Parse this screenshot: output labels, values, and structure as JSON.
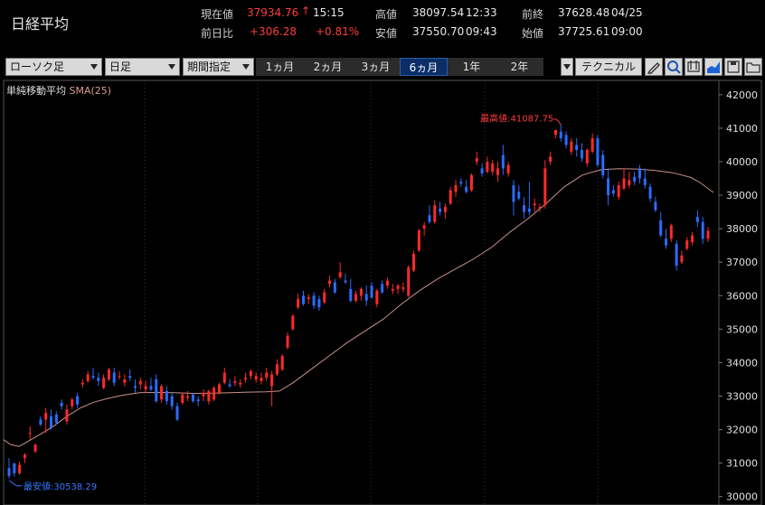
{
  "header": {
    "title": "日経平均",
    "current_label": "現在値",
    "current_value": "37934.76",
    "current_arrow": "↑",
    "current_time": "15:15",
    "change_label": "前日比",
    "change_value": "+306.28",
    "change_pct": "+0.81%",
    "high_label": "高値",
    "high_value": "38097.54",
    "high_time": "12:33",
    "low_label": "安値",
    "low_value": "37550.70",
    "low_time": "09:43",
    "prev_close_label": "前終",
    "prev_close_value": "37628.48",
    "prev_close_date": "04/25",
    "open_label": "始値",
    "open_value": "37725.61",
    "open_time": "09:00"
  },
  "toolbar": {
    "chart_type": "ローソク足",
    "interval": "日足",
    "range_mode": "期間指定",
    "periods": [
      "1ヵ月",
      "2ヵ月",
      "3ヵ月",
      "6ヵ月",
      "1年",
      "2年"
    ],
    "active_period": "6ヵ月",
    "technical_label": "テクニカル",
    "tool_icons": [
      "pencil-icon",
      "zoom-icon",
      "export-icon",
      "area-chart-icon",
      "save-icon",
      "folder-icon"
    ]
  },
  "indicator": {
    "name": "単純移動平均",
    "sma": "SMA(25)"
  },
  "colors": {
    "up": "#ff2a2a",
    "down": "#2b6cff",
    "sma": "#c8908a",
    "grid": "#3a3a3a",
    "bg": "#000000",
    "accent": "#0a2e66"
  },
  "chart_data": {
    "type": "candlestick",
    "yticks": [
      42000,
      41000,
      40000,
      39000,
      38000,
      37000,
      36000,
      35000,
      34000,
      33000,
      32000,
      31000,
      30000
    ],
    "ylim": [
      29750,
      42400
    ],
    "annotations": {
      "max_label": "最高値:41087.75",
      "max_value": 41087.75,
      "min_label": "最安値:30538.29",
      "min_value": 30538.29
    },
    "grid": "vertical month separators, dotted",
    "candles": [
      [
        30850,
        31150,
        30538,
        30620
      ],
      [
        30990,
        31020,
        30600,
        30700
      ],
      [
        30700,
        31050,
        30650,
        30950
      ],
      [
        31150,
        31300,
        31000,
        31250
      ],
      [
        31900,
        32100,
        31700,
        31900
      ],
      [
        31350,
        31580,
        31300,
        31550
      ],
      [
        32300,
        32400,
        32100,
        32150
      ],
      [
        32300,
        32650,
        31900,
        32500
      ],
      [
        32400,
        32600,
        32000,
        32050
      ],
      [
        32450,
        32550,
        32150,
        32200
      ],
      [
        32800,
        32900,
        32600,
        32700
      ],
      [
        32250,
        32750,
        32150,
        32600
      ],
      [
        32700,
        32950,
        32600,
        32900
      ],
      [
        33000,
        33100,
        32650,
        32750
      ],
      [
        33350,
        33500,
        33250,
        33400
      ],
      [
        33450,
        33750,
        33400,
        33650
      ],
      [
        33600,
        33850,
        33500,
        33550
      ],
      [
        33550,
        33700,
        33300,
        33450
      ],
      [
        33250,
        33650,
        33200,
        33550
      ],
      [
        33500,
        33850,
        33450,
        33800
      ],
      [
        33700,
        33850,
        33300,
        33400
      ],
      [
        33600,
        33750,
        33500,
        33600
      ],
      [
        33400,
        33650,
        33300,
        33500
      ],
      [
        33600,
        33800,
        33450,
        33550
      ],
      [
        33300,
        33500,
        33100,
        33250
      ],
      [
        33350,
        33550,
        33200,
        33450
      ],
      [
        33200,
        33450,
        33100,
        33300
      ],
      [
        33300,
        33550,
        33150,
        33200
      ],
      [
        33500,
        33650,
        32800,
        32850
      ],
      [
        32900,
        33350,
        32800,
        33300
      ],
      [
        33150,
        33300,
        32750,
        32850
      ],
      [
        33000,
        33100,
        32600,
        32700
      ],
      [
        32700,
        32800,
        32250,
        32300
      ],
      [
        32800,
        33100,
        32750,
        33050
      ],
      [
        32950,
        33150,
        32850,
        33000
      ],
      [
        33050,
        33100,
        32800,
        32850
      ],
      [
        32900,
        33000,
        32700,
        32850
      ],
      [
        33000,
        33200,
        32850,
        33100
      ],
      [
        32850,
        33200,
        32750,
        33150
      ],
      [
        32900,
        33300,
        32850,
        33250
      ],
      [
        33100,
        33400,
        33050,
        33350
      ],
      [
        33400,
        33850,
        33350,
        33700
      ],
      [
        33350,
        33500,
        33250,
        33300
      ],
      [
        33400,
        33600,
        33300,
        33450
      ],
      [
        33350,
        33500,
        33250,
        33400
      ],
      [
        33500,
        33700,
        33400,
        33550
      ],
      [
        33600,
        33800,
        33500,
        33750
      ],
      [
        33500,
        33700,
        33400,
        33600
      ],
      [
        33450,
        33700,
        33350,
        33550
      ],
      [
        33550,
        33850,
        33450,
        33700
      ],
      [
        33300,
        33750,
        32700,
        33650
      ],
      [
        33650,
        34100,
        33600,
        33950
      ],
      [
        33800,
        34250,
        33750,
        34200
      ],
      [
        34450,
        34900,
        34400,
        34800
      ],
      [
        35000,
        35450,
        34950,
        35400
      ],
      [
        35650,
        36050,
        35600,
        35900
      ],
      [
        36000,
        36150,
        35700,
        35750
      ],
      [
        35900,
        36050,
        35750,
        35950
      ],
      [
        36000,
        36100,
        35600,
        35700
      ],
      [
        35900,
        36000,
        35550,
        35650
      ],
      [
        35800,
        36200,
        35750,
        36100
      ],
      [
        36350,
        36600,
        36250,
        36450
      ],
      [
        36400,
        36500,
        36050,
        36100
      ],
      [
        36550,
        37000,
        36500,
        36700
      ],
      [
        36450,
        36650,
        36350,
        36400
      ],
      [
        36200,
        36500,
        35800,
        35850
      ],
      [
        35850,
        36150,
        35800,
        36050
      ],
      [
        36000,
        36250,
        35850,
        36200
      ],
      [
        36050,
        36300,
        35700,
        35850
      ],
      [
        36300,
        36400,
        35900,
        35950
      ],
      [
        35750,
        36200,
        35650,
        36150
      ],
      [
        36350,
        36450,
        36050,
        36100
      ],
      [
        36300,
        36550,
        36200,
        36450
      ],
      [
        36150,
        36350,
        36050,
        36200
      ],
      [
        36200,
        36350,
        36050,
        36300
      ],
      [
        36200,
        36400,
        36100,
        36250
      ],
      [
        36000,
        36900,
        35950,
        36850
      ],
      [
        36750,
        37350,
        36700,
        37250
      ],
      [
        37350,
        38000,
        37300,
        37950
      ],
      [
        38000,
        38200,
        37800,
        38100
      ],
      [
        38400,
        38700,
        38150,
        38200
      ],
      [
        38200,
        38850,
        38150,
        38700
      ],
      [
        38600,
        38800,
        38400,
        38500
      ],
      [
        38500,
        38750,
        38300,
        38650
      ],
      [
        38750,
        39250,
        38700,
        39150
      ],
      [
        39100,
        39450,
        38950,
        39300
      ],
      [
        39400,
        39500,
        39250,
        39350
      ],
      [
        39250,
        39450,
        39050,
        39100
      ],
      [
        39150,
        39650,
        39100,
        39600
      ],
      [
        40000,
        40300,
        39900,
        40100
      ],
      [
        39800,
        39950,
        39550,
        39650
      ],
      [
        39700,
        40150,
        39650,
        40000
      ],
      [
        39700,
        40050,
        39600,
        39950
      ],
      [
        39600,
        40000,
        39400,
        39800
      ],
      [
        40200,
        40500,
        39600,
        39800
      ],
      [
        39650,
        40000,
        39550,
        39900
      ],
      [
        39300,
        39450,
        38400,
        38800
      ],
      [
        39100,
        39300,
        38850,
        38900
      ],
      [
        38700,
        38950,
        38300,
        38500
      ],
      [
        38600,
        39400,
        38400,
        38500
      ],
      [
        38700,
        38900,
        38500,
        38750
      ],
      [
        38600,
        38750,
        38500,
        38650
      ],
      [
        38700,
        40050,
        38600,
        39800
      ],
      [
        40000,
        40300,
        39900,
        40150
      ],
      [
        40800,
        40950,
        40700,
        40950
      ],
      [
        40900,
        41087.75,
        40600,
        40700
      ],
      [
        40800,
        40900,
        40400,
        40500
      ],
      [
        40300,
        40700,
        40200,
        40600
      ],
      [
        40500,
        40700,
        40150,
        40350
      ],
      [
        40350,
        40550,
        40000,
        40100
      ],
      [
        39950,
        40400,
        39850,
        40350
      ],
      [
        40300,
        40850,
        40250,
        40700
      ],
      [
        40700,
        40800,
        39850,
        39900
      ],
      [
        40200,
        40350,
        39500,
        39600
      ],
      [
        39500,
        39800,
        38700,
        39000
      ],
      [
        39150,
        39300,
        38950,
        39050
      ],
      [
        38950,
        39400,
        38850,
        39300
      ],
      [
        39200,
        39800,
        39150,
        39500
      ],
      [
        39300,
        39700,
        39200,
        39450
      ],
      [
        39550,
        39700,
        39300,
        39400
      ],
      [
        39800,
        39900,
        39350,
        39500
      ],
      [
        39500,
        39800,
        39200,
        39300
      ],
      [
        39250,
        39350,
        38800,
        38900
      ],
      [
        38800,
        38950,
        38500,
        38550
      ],
      [
        38250,
        38500,
        37750,
        37800
      ],
      [
        37700,
        38000,
        37400,
        37500
      ],
      [
        37700,
        38150,
        37600,
        38100
      ],
      [
        37550,
        37650,
        36750,
        36900
      ],
      [
        37000,
        37350,
        36950,
        37200
      ],
      [
        37400,
        37750,
        37350,
        37650
      ],
      [
        37600,
        37900,
        37500,
        37800
      ],
      [
        38350,
        38550,
        38050,
        38200
      ],
      [
        38200,
        38350,
        37550,
        37700
      ],
      [
        37700,
        38050,
        37600,
        37934.76
      ]
    ],
    "sma": [
      [
        0,
        31700
      ],
      [
        8,
        31550
      ],
      [
        17,
        31500
      ],
      [
        27,
        31650
      ],
      [
        40,
        31850
      ],
      [
        55,
        32100
      ],
      [
        70,
        32400
      ],
      [
        85,
        32650
      ],
      [
        100,
        32820
      ],
      [
        115,
        32930
      ],
      [
        130,
        33020
      ],
      [
        150,
        33100
      ],
      [
        170,
        33110
      ],
      [
        190,
        33100
      ],
      [
        210,
        33080
      ],
      [
        230,
        33090
      ],
      [
        250,
        33100
      ],
      [
        270,
        33120
      ],
      [
        290,
        33130
      ],
      [
        305,
        33150
      ],
      [
        320,
        33400
      ],
      [
        340,
        33800
      ],
      [
        360,
        34200
      ],
      [
        380,
        34600
      ],
      [
        400,
        34950
      ],
      [
        420,
        35300
      ],
      [
        440,
        35750
      ],
      [
        460,
        36150
      ],
      [
        480,
        36500
      ],
      [
        500,
        36800
      ],
      [
        520,
        37100
      ],
      [
        540,
        37450
      ],
      [
        560,
        37900
      ],
      [
        580,
        38300
      ],
      [
        600,
        38750
      ],
      [
        620,
        39250
      ],
      [
        640,
        39600
      ],
      [
        660,
        39760
      ],
      [
        680,
        39790
      ],
      [
        700,
        39780
      ],
      [
        720,
        39740
      ],
      [
        740,
        39670
      ],
      [
        760,
        39530
      ],
      [
        770,
        39380
      ],
      [
        785,
        39080
      ]
    ]
  }
}
